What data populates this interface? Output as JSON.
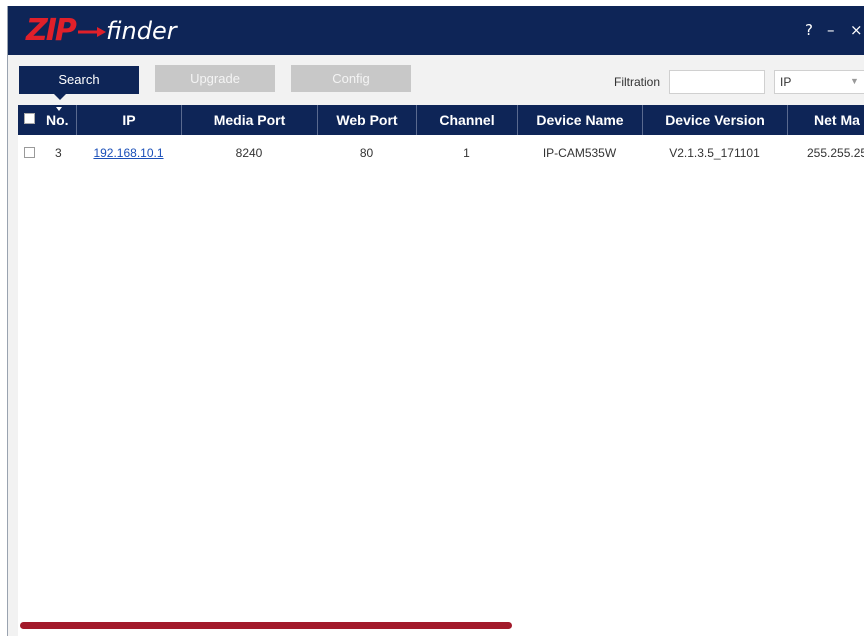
{
  "app": {
    "logo_zip": "ZIP",
    "logo_finder": "finder",
    "help": "?",
    "minimize": "–",
    "close": "×"
  },
  "toolbar": {
    "search": "Search",
    "upgrade": "Upgrade",
    "config": "Config",
    "filtration_label": "Filtration",
    "filtration_value": "",
    "filter_field": "IP"
  },
  "table": {
    "columns": [
      "No.",
      "IP",
      "Media Port",
      "Web Port",
      "Channel",
      "Device Name",
      "Device Version",
      "Net Ma"
    ],
    "rows": [
      {
        "no": "3",
        "ip": "192.168.10.1",
        "media_port": "8240",
        "web_port": "80",
        "channel": "1",
        "device_name": "IP-CAM535W",
        "device_version": "V2.1.3.5_171101",
        "net_mask": "255.255.25"
      }
    ]
  },
  "colors": {
    "header_bg": "#0e2557",
    "accent_red": "#e0202a",
    "scroll_thumb": "#a21a2a",
    "link": "#1a4fb8"
  },
  "icons": [
    "arrow-logo-icon",
    "help-icon",
    "minimize-icon",
    "close-icon",
    "dropdown-chevron-icon",
    "checkbox-icon"
  ]
}
